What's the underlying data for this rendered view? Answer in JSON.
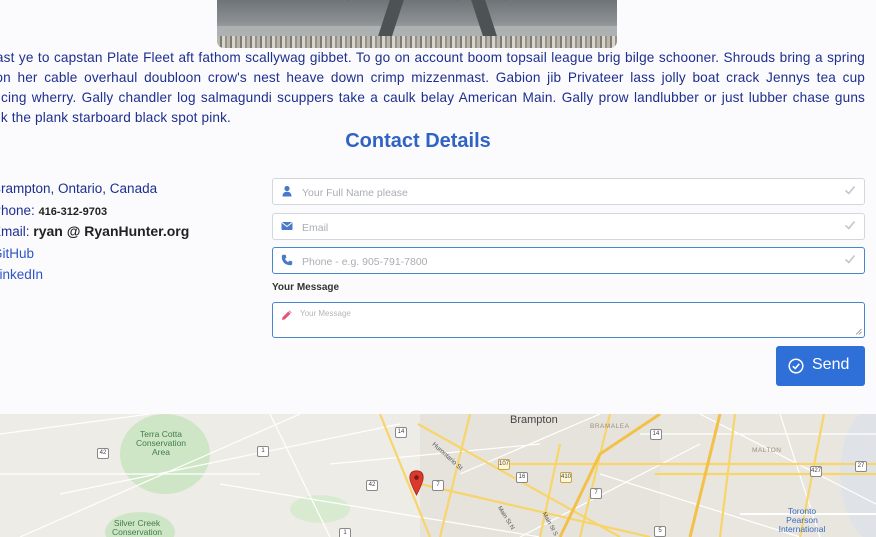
{
  "about": {
    "lines": [
      "Avast ye to capstan Plate Fleet aft fathom scallywag gibbet. To go on account boom topsail league brig bilge schooner. Shrouds bring a spring",
      "upon her cable overhaul doubloon crow's nest heave down crimp mizzenmast. Gabion jib Privateer lass jolly boat crack Jennys tea cup",
      "splicing wherry. Gally chandler log salmagundi scuppers take a caulk belay American Main. Gally prow landlubber or just lubber chase guns",
      "walk the plank starboard black spot pink."
    ]
  },
  "contact": {
    "title": "Contact Details",
    "location": "Brampton, Ontario, Canada",
    "phone_label": "Phone:",
    "phone_value": "416-312-9703",
    "email_label": "Email:",
    "email_value": "ryan @ RyanHunter.org",
    "github": "GitHub",
    "linkedin": "LinkedIn"
  },
  "form": {
    "name_placeholder": "Your Full Name please",
    "email_placeholder": "Email",
    "phone_placeholder": "Phone - e.g. 905-791-7800",
    "message_label": "Your Message",
    "message_placeholder": "Your Message",
    "send_label": "Send"
  },
  "map": {
    "labels": {
      "brampton": "Brampton",
      "bramalea": "BRAMALEA",
      "malton": "MALTON",
      "terra_cotta": "Terra Cotta Conservation Area",
      "silver_creek": "Silver Creek Conservation",
      "pearson": "Toronto Pearson International",
      "hurontario": "Hurontario St",
      "main_st_n": "Main St N",
      "main_st_s": "Main St S"
    },
    "shields": [
      "42",
      "1",
      "14",
      "42",
      "7",
      "107",
      "410",
      "14",
      "427",
      "27",
      "16",
      "7",
      "1",
      "5"
    ]
  },
  "colors": {
    "accent": "#2f6fd8",
    "title": "#2f63c4",
    "text": "#1d2f8f",
    "pin": "#d93a2b"
  }
}
